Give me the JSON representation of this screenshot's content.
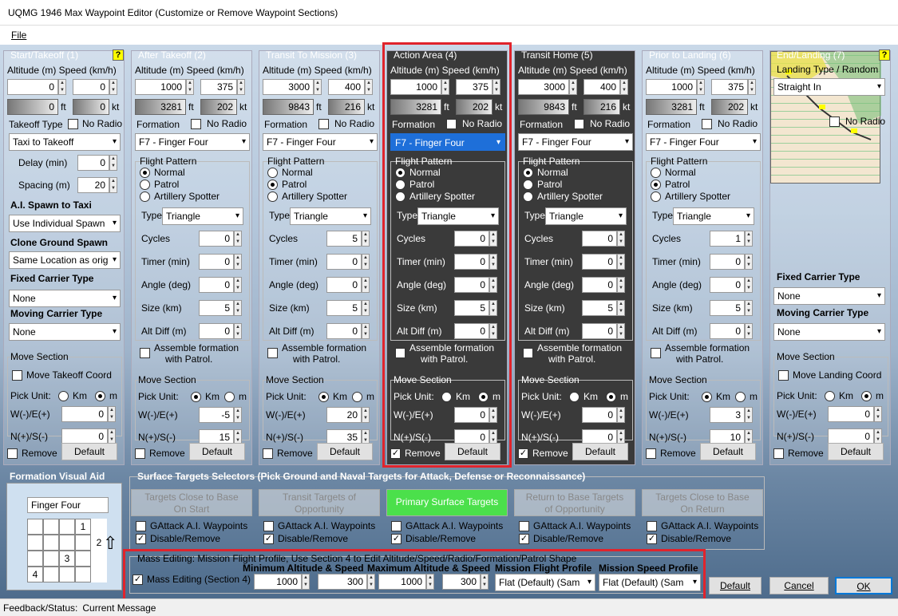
{
  "window": {
    "title": "UQMG 1946 Max Waypoint Editor (Customize or Remove Waypoint Sections)"
  },
  "menu": {
    "file": "File"
  },
  "labels": {
    "alt_speed": "Altitude (m) Speed (km/h)",
    "ft": "ft",
    "kt": "kt",
    "formation": "Formation",
    "takeoff_type": "Takeoff Type",
    "no_radio": "No Radio",
    "flight_pattern": "Flight Pattern",
    "normal": "Normal",
    "patrol": "Patrol",
    "artillery": "Artillery Spotter",
    "type": "Type",
    "cycles": "Cycles",
    "timer": "Timer (min)",
    "angle": "Angle (deg)",
    "size": "Size (km)",
    "altdiff": "Alt Diff (m)",
    "assemble": "Assemble formation",
    "with_patrol": "with Patrol.",
    "move_section": "Move Section",
    "pick_unit": "Pick Unit:",
    "km": "Km",
    "m": "m",
    "we": "W(-)/E(+)",
    "ns": "N(+)/S(-)",
    "remove": "Remove",
    "default": "Default",
    "delay": "Delay (min)",
    "spacing": "Spacing (m)",
    "ai_spawn": "A.I. Spawn to Taxi",
    "clone_ground": "Clone Ground Spawn",
    "fixed_carrier": "Fixed Carrier Type",
    "moving_carrier": "Moving Carrier Type",
    "move_takeoff": "Move Takeoff Coord",
    "move_landing": "Move Landing Coord",
    "landing_type": "Landing Type / Random",
    "qm": "?"
  },
  "columns": [
    {
      "title": "Start/Takeoff (1)",
      "alt": "0",
      "speed": "0",
      "ft": "0",
      "kt": "0",
      "takeoff": "Taxi to Takeoff",
      "delay": "0",
      "spacing": "20",
      "ai_spawn": "Use Individual Spawn",
      "clone": "Same Location as orig",
      "fixed": "None",
      "moving": "None",
      "we": "0",
      "ns": "0"
    },
    {
      "title": "After Takeoff (2)",
      "alt": "1000",
      "speed": "375",
      "ft": "3281",
      "kt": "202",
      "formation": "F7 - Finger Four",
      "ptype": "Triangle",
      "cycles": "0",
      "timer": "0",
      "angle": "0",
      "size": "5",
      "altdiff": "0",
      "we": "-5",
      "ns": "15"
    },
    {
      "title": "Transit To Mission (3)",
      "alt": "3000",
      "speed": "400",
      "ft": "9843",
      "kt": "216",
      "formation": "F7 - Finger Four",
      "ptype": "Triangle",
      "cycles": "5",
      "timer": "0",
      "angle": "0",
      "size": "5",
      "altdiff": "0",
      "we": "20",
      "ns": "35"
    },
    {
      "title": "Action Area (4)",
      "alt": "1000",
      "speed": "375",
      "ft": "3281",
      "kt": "202",
      "formation": "F7 - Finger Four",
      "ptype": "Triangle",
      "cycles": "0",
      "timer": "0",
      "angle": "0",
      "size": "5",
      "altdiff": "0",
      "we": "0",
      "ns": "0"
    },
    {
      "title": "Transit Home (5)",
      "alt": "3000",
      "speed": "400",
      "ft": "9843",
      "kt": "216",
      "formation": "F7 - Finger Four",
      "ptype": "Triangle",
      "cycles": "0",
      "timer": "0",
      "angle": "0",
      "size": "5",
      "altdiff": "0",
      "we": "0",
      "ns": "0"
    },
    {
      "title": "Prior to Landing (6)",
      "alt": "1000",
      "speed": "375",
      "ft": "3281",
      "kt": "202",
      "formation": "F7 - Finger Four",
      "ptype": "Triangle",
      "cycles": "1",
      "timer": "0",
      "angle": "0",
      "size": "5",
      "altdiff": "0",
      "we": "3",
      "ns": "10"
    },
    {
      "title": "End/Landing (7)",
      "landing": "Straight In",
      "fixed": "None",
      "moving": "None",
      "we": "0",
      "ns": "0"
    }
  ],
  "formation_aid": {
    "title": "Formation Visual Aid",
    "name": "Finger Four",
    "cells": [
      "1",
      "2",
      "3",
      "4"
    ]
  },
  "surface": {
    "title": "Surface Targets Selectors (Pick Ground and Naval Targets for Attack, Defense or Reconnaissance)",
    "buttons": [
      [
        "Targets Close to Base",
        "On Start"
      ],
      [
        "Transit Targets of",
        "Opportunity"
      ],
      [
        "Primary Surface Targets",
        ""
      ],
      [
        "Return to Base Targets",
        "of Opportunity"
      ],
      [
        "Targets Close to Base",
        "On Return"
      ]
    ],
    "gattack": "GAttack A.I. Waypoints",
    "disable": "Disable/Remove"
  },
  "mass": {
    "title": "Mass Editing:  Mission Flight Profile, Use Section 4 to Edit Altitude/Speed/Radio/Formation/Patrol Shape",
    "checkbox": "Mass Editing (Section 4)",
    "min_label": "Minimum Altitude & Speed",
    "max_label": "Maximum Altitude & Speed",
    "profile_label": "Mission Flight Profile",
    "speed_profile_label": "Mission Speed Profile",
    "min_alt": "1000",
    "min_speed": "300",
    "max_alt": "1000",
    "max_speed": "300",
    "profile": "Flat (Default) (Sam",
    "speed_profile": "Flat (Default) (Sam"
  },
  "footer": {
    "default": "Default",
    "cancel": "Cancel",
    "ok": "OK"
  },
  "status": {
    "label": "Feedback/Status:",
    "message": "Current Message"
  }
}
